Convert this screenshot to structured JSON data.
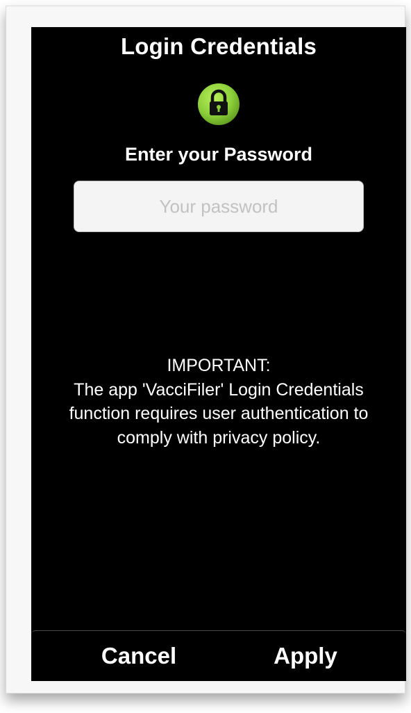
{
  "dialog": {
    "title": "Login Credentials",
    "icon": "lock-icon",
    "prompt": "Enter your Password",
    "password_placeholder": "Your password",
    "password_value": "",
    "notice_lines": [
      "IMPORTANT:",
      "The app 'VacciFiler' Login Credentials",
      "function requires user authentication to",
      "comply with privacy policy."
    ]
  },
  "actions": {
    "cancel_label": "Cancel",
    "apply_label": "Apply"
  },
  "colors": {
    "background": "#000000",
    "text": "#ffffff",
    "lock_green": "#8ccf3a",
    "input_bg": "#f4f4f4"
  }
}
